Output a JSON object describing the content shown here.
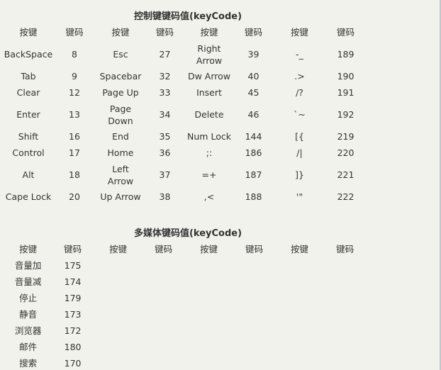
{
  "section1": {
    "title": "控制键键码值(keyCode)",
    "headers": [
      "按键",
      "键码",
      "按键",
      "键码",
      "按键",
      "键码",
      "按键",
      "键码"
    ],
    "rows": [
      {
        "tall": false,
        "cells": [
          "",
          "",
          "",
          "",
          "",
          "",
          "",
          ""
        ]
      },
      {
        "tall": true,
        "cells": [
          "BackSpace",
          "8",
          "Esc",
          "27",
          "Right Arrow",
          "39",
          "-_",
          "189"
        ]
      },
      {
        "tall": false,
        "cells": [
          "Tab",
          "9",
          "Spacebar",
          "32",
          "Dw Arrow",
          "40",
          ".>",
          "190"
        ]
      },
      {
        "tall": false,
        "cells": [
          "Clear",
          "12",
          "Page Up",
          "33",
          "Insert",
          "45",
          "/?",
          "191"
        ]
      },
      {
        "tall": true,
        "cells": [
          "Enter",
          "13",
          "Page Down",
          "34",
          "Delete",
          "46",
          "`~",
          "192"
        ]
      },
      {
        "tall": false,
        "cells": [
          "Shift",
          "16",
          "End",
          "35",
          "Num Lock",
          "144",
          "[{",
          "219"
        ]
      },
      {
        "tall": false,
        "cells": [
          "Control",
          "17",
          "Home",
          "36",
          ";:",
          "186",
          "/|",
          "220"
        ]
      },
      {
        "tall": true,
        "cells": [
          "Alt",
          "18",
          "Left Arrow",
          "37",
          "=+",
          "187",
          "]}",
          "221"
        ]
      },
      {
        "tall": false,
        "cells": [
          "Cape Lock",
          "20",
          "Up Arrow",
          "38",
          ",<",
          "188",
          "'\"",
          "222"
        ]
      }
    ]
  },
  "section2": {
    "title": "多媒体键码值(keyCode)",
    "headers": [
      "按键",
      "键码",
      "按键",
      "键码",
      "按键",
      "键码",
      "按键",
      "键码"
    ],
    "rows": [
      [
        "音量加",
        "175"
      ],
      [
        "音量减",
        "174"
      ],
      [
        "停止",
        "179"
      ],
      [
        "静音",
        "173"
      ],
      [
        "浏览器",
        "172"
      ],
      [
        "邮件",
        "180"
      ],
      [
        "搜索",
        "170"
      ]
    ]
  }
}
